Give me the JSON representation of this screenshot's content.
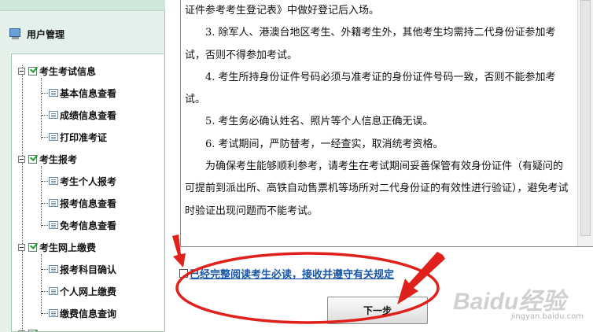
{
  "sidebar": {
    "title": "用户管理",
    "groups": [
      {
        "label": "考生考试信息",
        "items": [
          "基本信息查看",
          "成绩信息查看",
          "打印准考证"
        ]
      },
      {
        "label": "考生报考",
        "items": [
          "考生个人报考",
          "报考信息查看",
          "免考信息查看"
        ]
      },
      {
        "label": "考生网上缴费",
        "items": [
          "报考科目确认",
          "个人网上缴费",
          "缴费信息查询"
        ]
      }
    ]
  },
  "notice": {
    "lines": [
      "证件参考考生登记表》中做好登记后入场。",
      "3. 除军人、港澳台地区考生、外籍考生外，其他考生均需持二代身份证参加考试，否则不得参加考试。",
      "4. 考生所持身份证件号码必须与准考证的身份证件号码一致，否则不能参加考试。",
      "5. 考生务必确认姓名、照片等个人信息正确无误。",
      "6. 考试期间，严防替考，一经查实，取消统考资格。",
      "为确保考生能够顺利参考，请考生在考试期间妥善保管有效身份证件（有疑问的可提前到派出所、高铁自动售票机等场所对二代身份证的有效性进行验证），避免考试时验证出现问题而不能考试。"
    ]
  },
  "agreement": {
    "label": "已经完整阅读考生必读，接收并遵守有关规定",
    "checked": false
  },
  "next_button": {
    "label": "下一步"
  },
  "watermark": {
    "main": "Baidu经验",
    "sub": "jingyan.baidu.com"
  },
  "colors": {
    "sidebar_bg": "#e3f1ea",
    "annotation_red": "#e0201b",
    "link_blue": "#1a56a8"
  },
  "icons": {
    "user_mgmt": "user-management-icon",
    "group": "checked-book-icon",
    "leaf": "document-icon"
  }
}
